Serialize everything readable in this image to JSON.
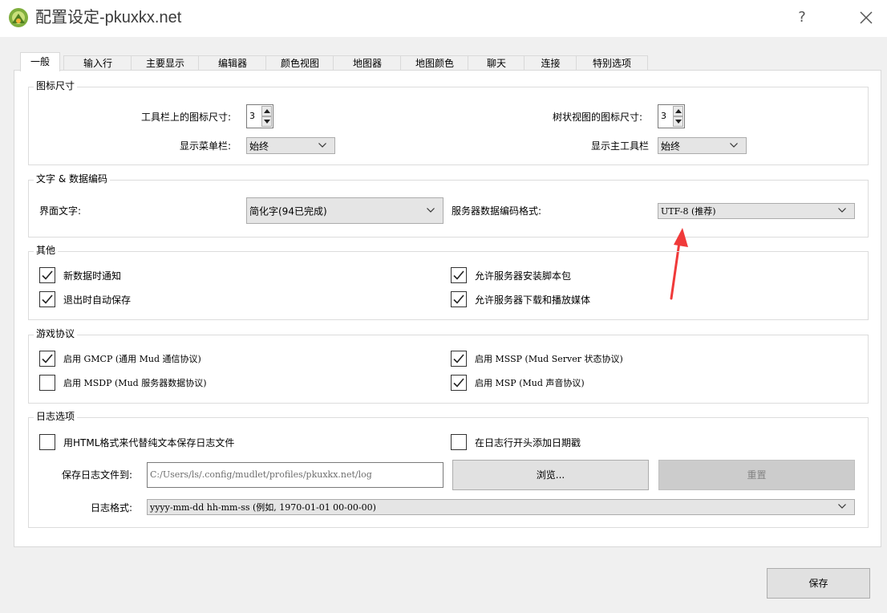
{
  "window": {
    "title": "配置设定-pkuxkx.net",
    "help": "?",
    "accent": "#f03a3a"
  },
  "tabs": [
    "一般",
    "输入行",
    "主要显示",
    "编辑器",
    "颜色视图",
    "地图器",
    "地图颜色",
    "聊天",
    "连接",
    "特别选项"
  ],
  "icon_size": {
    "title": "图标尺寸",
    "toolbar_icon_label": "工具栏上的图标尺寸:",
    "toolbar_icon_value": "3",
    "tree_icon_label": "树状视图的图标尺寸:",
    "tree_icon_value": "3",
    "show_menubar_label": "显示菜单栏:",
    "show_menubar_value": "始终",
    "show_toolbar_label": "显示主工具栏",
    "show_toolbar_value": "始终"
  },
  "encoding": {
    "title": "文字 & 数据编码",
    "ui_text_label": "界面文字:",
    "ui_text_value": "简化字(94已完成)",
    "server_encoding_label": "服务器数据编码格式:",
    "server_encoding_value": "UTF-8 (推荐)"
  },
  "other": {
    "title": "其他",
    "items": [
      {
        "label": "新数据时通知",
        "checked": true
      },
      {
        "label": "允许服务器安装脚本包",
        "checked": true
      },
      {
        "label": "退出时自动保存",
        "checked": true
      },
      {
        "label": "允许服务器下载和播放媒体",
        "checked": true
      }
    ]
  },
  "protocols": {
    "title": "游戏协议",
    "items": [
      {
        "label": "启用 GMCP (通用 Mud 通信协议)",
        "checked": true
      },
      {
        "label": "启用 MSSP (Mud Server 状态协议)",
        "checked": true
      },
      {
        "label": "启用 MSDP (Mud 服务器数据协议)",
        "checked": false
      },
      {
        "label": "启用 MSP (Mud 声音协议)",
        "checked": true
      }
    ]
  },
  "log": {
    "title": "日志选项",
    "html_label": "用HTML格式来代替纯文本保存日志文件",
    "html_checked": false,
    "timestamp_label": "在日志行开头添加日期戳",
    "timestamp_checked": false,
    "save_to_label": "保存日志文件到:",
    "path_value": "C:/Users/ls/.config/mudlet/profiles/pkuxkx.net/log",
    "browse_label": "浏览...",
    "reset_label": "重置",
    "format_label": "日志格式:",
    "format_value": "yyyy-mm-dd hh-mm-ss (例如, 1970-01-01 00-00-00)"
  },
  "save_label": "保存"
}
